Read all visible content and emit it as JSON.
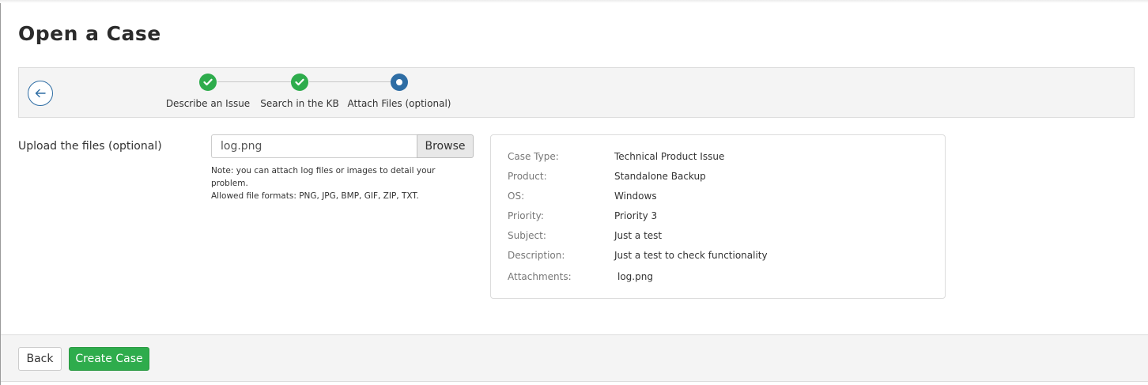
{
  "page": {
    "title": "Open a Case"
  },
  "stepper": {
    "back_icon": "arrow-left-icon",
    "steps": [
      {
        "label": "Describe an Issue",
        "status": "complete",
        "icon": "check-icon"
      },
      {
        "label": "Search in the KB",
        "status": "complete",
        "icon": "check-icon"
      },
      {
        "label": "Attach Files (optional)",
        "status": "current",
        "icon": "dot-icon"
      }
    ]
  },
  "upload": {
    "label": "Upload the files (optional)",
    "file_value": "log.png",
    "browse_label": "Browse",
    "note_line1": "Note: you can attach log files or images to detail your problem.",
    "note_line2": "Allowed file formats: PNG, JPG, BMP, GIF, ZIP, TXT."
  },
  "summary": {
    "rows": [
      {
        "label": "Case Type:",
        "value": "Technical Product Issue"
      },
      {
        "label": "Product:",
        "value": "Standalone Backup"
      },
      {
        "label": "OS:",
        "value": "Windows"
      },
      {
        "label": "Priority:",
        "value": "Priority 3"
      },
      {
        "label": "Subject:",
        "value": "Just a test"
      },
      {
        "label": "Description:",
        "value": "Just a test to check functionality"
      },
      {
        "label": "Attachments:",
        "value": "log.png"
      }
    ]
  },
  "footer": {
    "back_label": "Back",
    "create_label": "Create Case"
  },
  "colors": {
    "complete": "#2eac4c",
    "current": "#2e6da4",
    "primary_button": "#2eac4c"
  }
}
